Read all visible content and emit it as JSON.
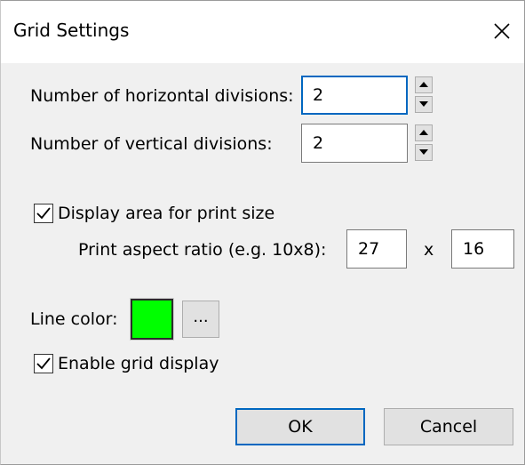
{
  "dialog": {
    "title": "Grid Settings",
    "close_icon": "close-icon"
  },
  "grid": {
    "horizontal_label": "Number of horizontal divisions:",
    "horizontal_value": "2",
    "vertical_label": "Number of vertical divisions:",
    "vertical_value": "2"
  },
  "print_area": {
    "checkbox_label": "Display area for print size",
    "checked": true,
    "ratio_label": "Print aspect ratio (e.g. 10x8):",
    "ratio_width": "27",
    "ratio_separator": "x",
    "ratio_height": "16"
  },
  "line_color": {
    "label": "Line color:",
    "color": "#00ff00",
    "browse_label": "..."
  },
  "grid_display": {
    "checkbox_label": "Enable grid display",
    "checked": true
  },
  "buttons": {
    "ok_label": "OK",
    "cancel_label": "Cancel"
  },
  "colors": {
    "accent": "#0067c0",
    "window_bg": "#f0f0f0",
    "title_bg": "#ffffff"
  }
}
